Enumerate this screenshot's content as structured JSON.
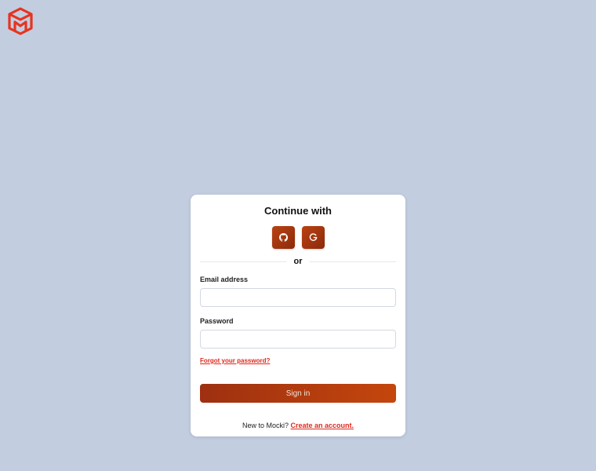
{
  "brand": {
    "logo_icon": "cube-m-logo-icon",
    "color": "#e8331e"
  },
  "card": {
    "title": "Continue with",
    "social": [
      {
        "name": "github",
        "icon": "github-icon"
      },
      {
        "name": "google",
        "icon": "google-icon"
      }
    ],
    "divider_text": "or",
    "email": {
      "label": "Email address",
      "value": "",
      "placeholder": ""
    },
    "password": {
      "label": "Password",
      "value": "",
      "placeholder": ""
    },
    "forgot_link": "Forgot your password?",
    "signin_label": "Sign in",
    "footer": {
      "text": "New to Mocki?",
      "link": "Create an account."
    }
  },
  "colors": {
    "background": "#c2cde0",
    "accent": "#b33c11",
    "link": "#e0271d"
  }
}
